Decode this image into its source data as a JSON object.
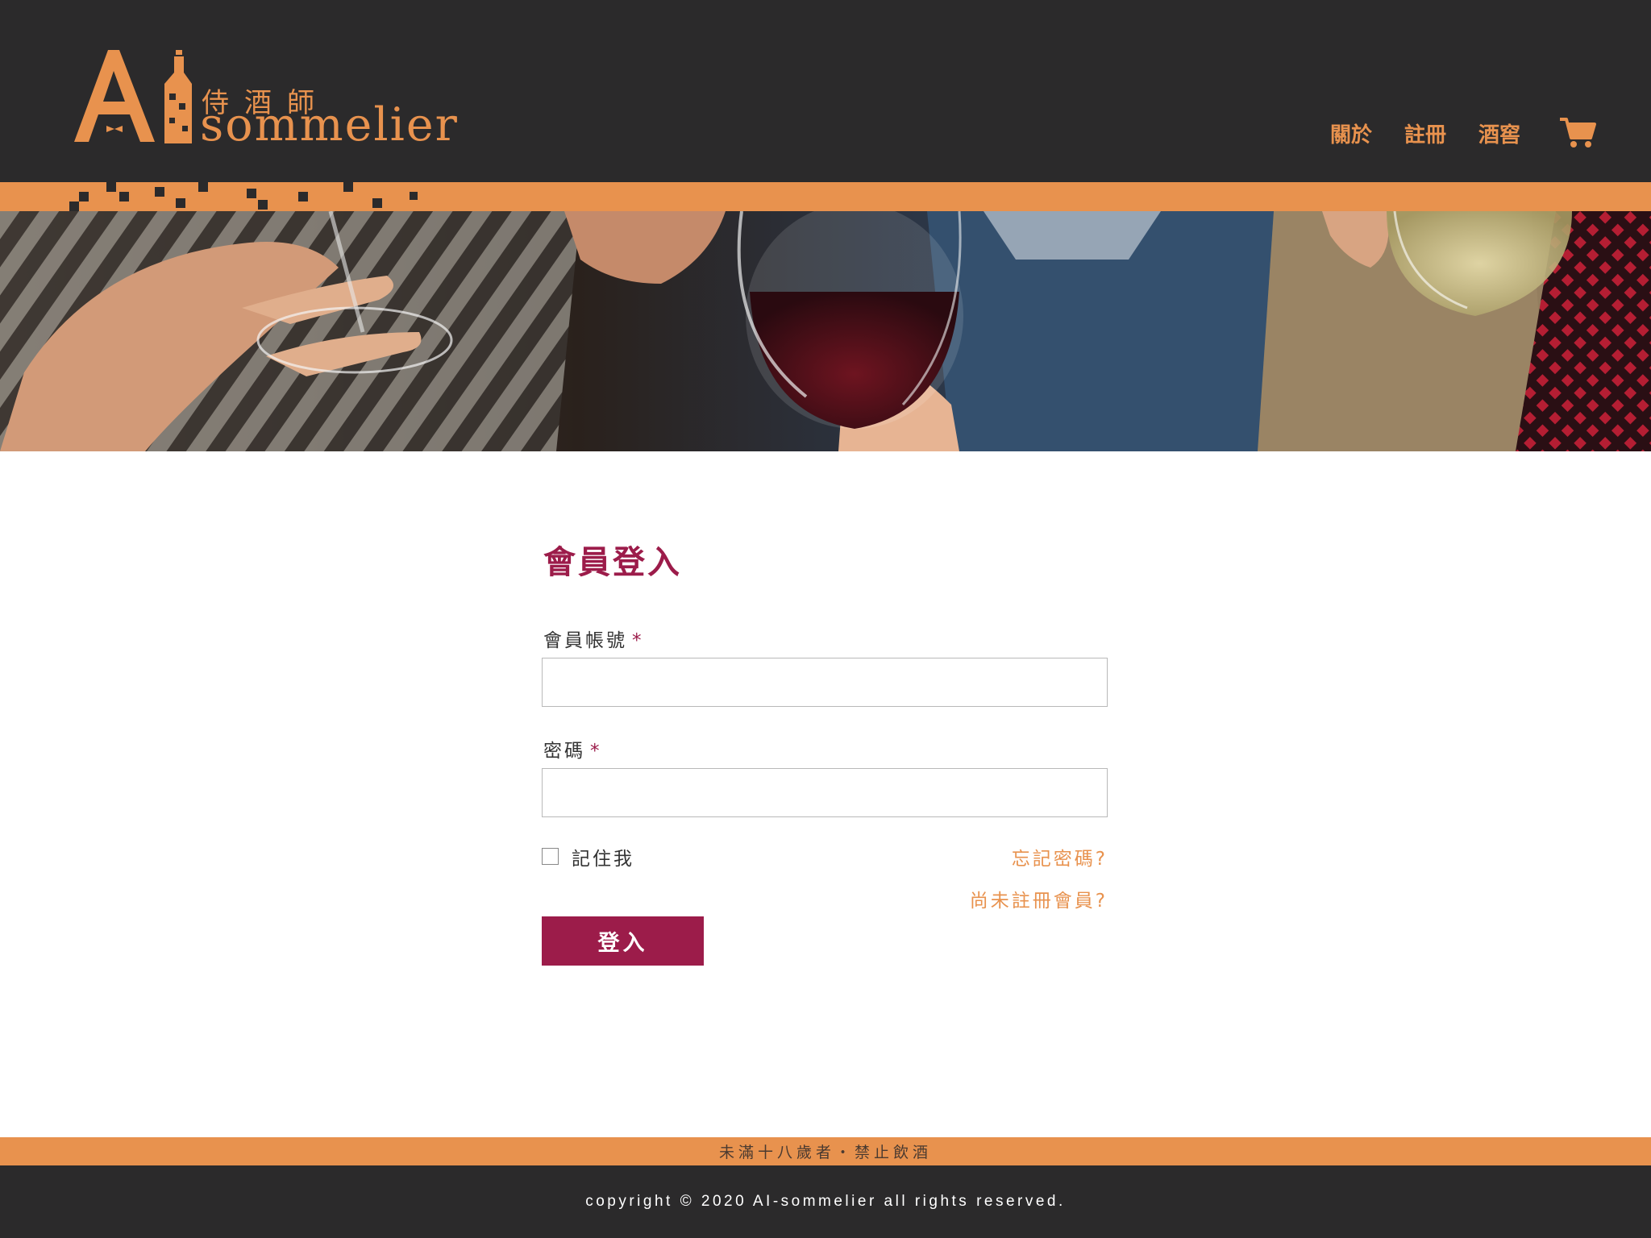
{
  "brand": {
    "logo_letters": "AI",
    "logo_cn": "侍酒師",
    "logo_en": "sommelier"
  },
  "nav": {
    "items": [
      {
        "label": "關於"
      },
      {
        "label": "註冊"
      },
      {
        "label": "酒窖"
      }
    ],
    "cart_icon": "cart-icon"
  },
  "hero": {
    "description_icon": "wine-toast-photo"
  },
  "login": {
    "title": "會員登入",
    "username_label": "會員帳號",
    "username_value": "",
    "password_label": "密碼",
    "password_value": "",
    "required_mark": "*",
    "remember_label": "記住我",
    "remember_checked": false,
    "forgot_link": "忘記密碼?",
    "register_link": "尚未註冊會員?",
    "submit_label": "登入"
  },
  "footer": {
    "warning": "未滿十八歲者・禁止飲酒",
    "copyright": "copyright © 2020 AI-sommelier all rights reserved."
  },
  "colors": {
    "dark": "#2b2a2b",
    "orange": "#e8924e",
    "wine": "#9c1c4a"
  }
}
